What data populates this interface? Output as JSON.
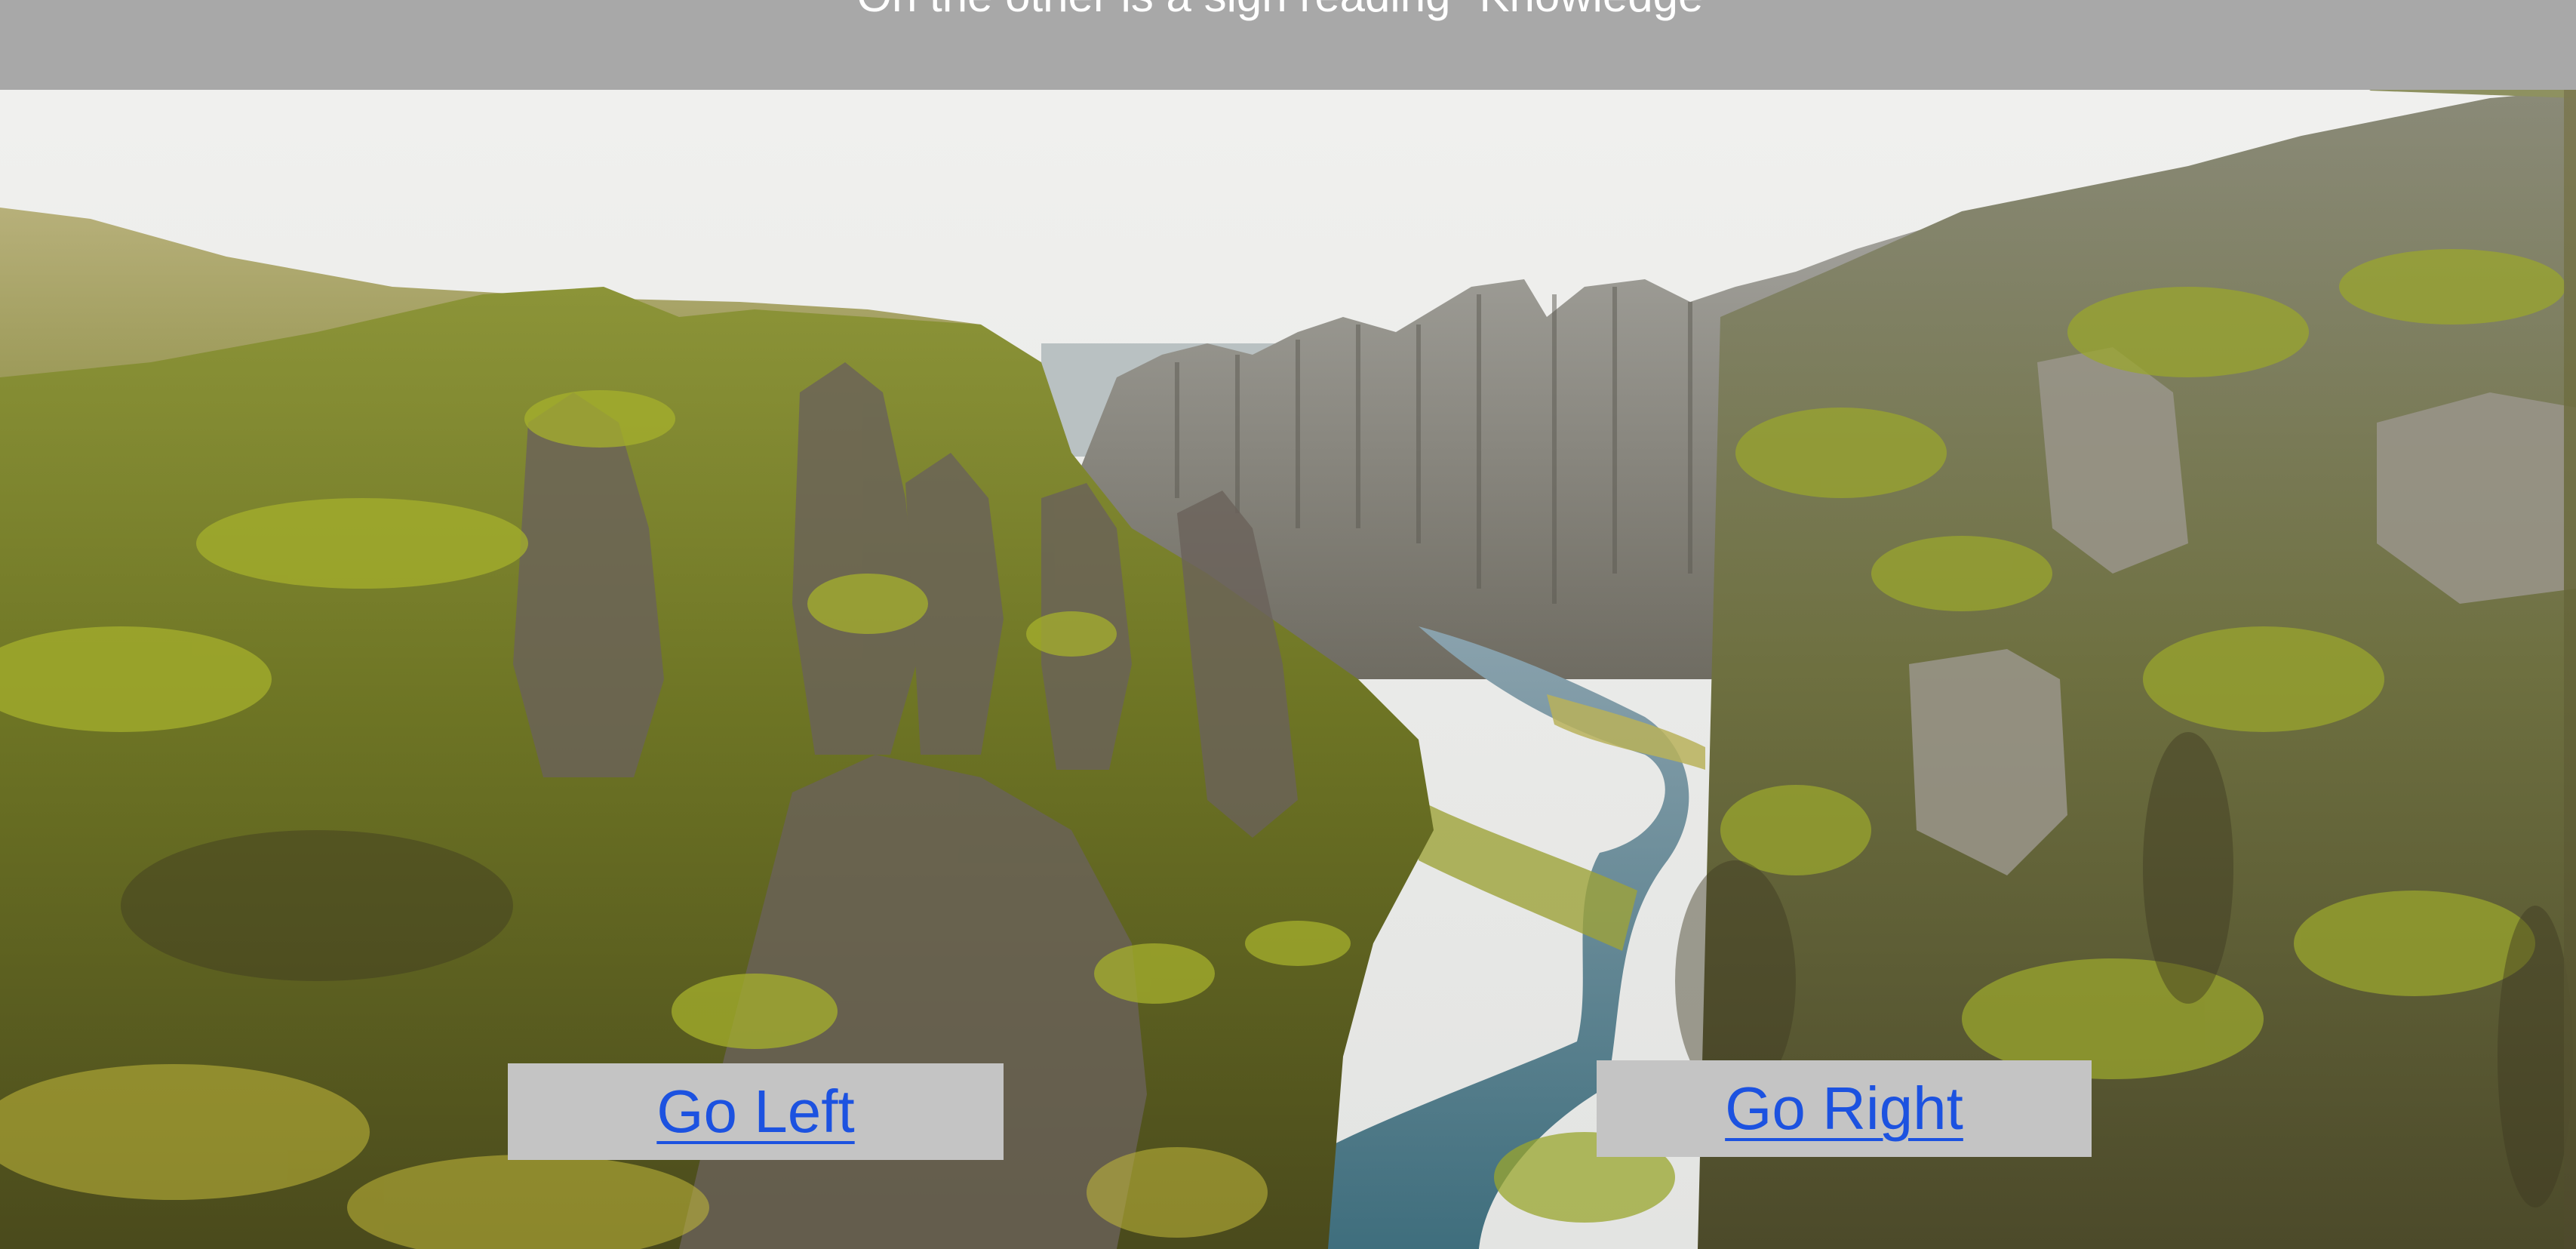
{
  "caption": {
    "text": "On the other is a sign reading \"Knowledge\""
  },
  "choices": {
    "left_label": "Go Left",
    "right_label": "Go Right"
  },
  "scene": {
    "sky_color": "#ececea",
    "moss_color": "#7a8a22",
    "rock_color": "#6b655d",
    "river_color": "#5d7d8a"
  },
  "colors": {
    "caption_bar": "#a8a8a8",
    "button_bg": "#c4c4c4",
    "link_color": "#1c52e0"
  }
}
